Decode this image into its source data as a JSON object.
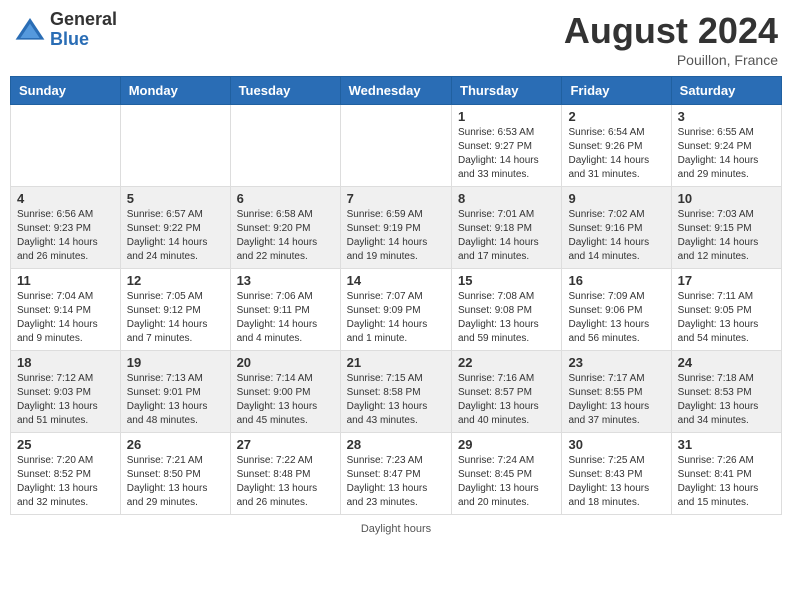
{
  "header": {
    "logo_general": "General",
    "logo_blue": "Blue",
    "month_year": "August 2024",
    "location": "Pouillon, France"
  },
  "days_of_week": [
    "Sunday",
    "Monday",
    "Tuesday",
    "Wednesday",
    "Thursday",
    "Friday",
    "Saturday"
  ],
  "weeks": [
    [
      {
        "day": "",
        "sunrise": "",
        "sunset": "",
        "daylight": ""
      },
      {
        "day": "",
        "sunrise": "",
        "sunset": "",
        "daylight": ""
      },
      {
        "day": "",
        "sunrise": "",
        "sunset": "",
        "daylight": ""
      },
      {
        "day": "",
        "sunrise": "",
        "sunset": "",
        "daylight": ""
      },
      {
        "day": "1",
        "sunrise": "6:53 AM",
        "sunset": "9:27 PM",
        "daylight": "14 hours and 33 minutes."
      },
      {
        "day": "2",
        "sunrise": "6:54 AM",
        "sunset": "9:26 PM",
        "daylight": "14 hours and 31 minutes."
      },
      {
        "day": "3",
        "sunrise": "6:55 AM",
        "sunset": "9:24 PM",
        "daylight": "14 hours and 29 minutes."
      }
    ],
    [
      {
        "day": "4",
        "sunrise": "6:56 AM",
        "sunset": "9:23 PM",
        "daylight": "14 hours and 26 minutes."
      },
      {
        "day": "5",
        "sunrise": "6:57 AM",
        "sunset": "9:22 PM",
        "daylight": "14 hours and 24 minutes."
      },
      {
        "day": "6",
        "sunrise": "6:58 AM",
        "sunset": "9:20 PM",
        "daylight": "14 hours and 22 minutes."
      },
      {
        "day": "7",
        "sunrise": "6:59 AM",
        "sunset": "9:19 PM",
        "daylight": "14 hours and 19 minutes."
      },
      {
        "day": "8",
        "sunrise": "7:01 AM",
        "sunset": "9:18 PM",
        "daylight": "14 hours and 17 minutes."
      },
      {
        "day": "9",
        "sunrise": "7:02 AM",
        "sunset": "9:16 PM",
        "daylight": "14 hours and 14 minutes."
      },
      {
        "day": "10",
        "sunrise": "7:03 AM",
        "sunset": "9:15 PM",
        "daylight": "14 hours and 12 minutes."
      }
    ],
    [
      {
        "day": "11",
        "sunrise": "7:04 AM",
        "sunset": "9:14 PM",
        "daylight": "14 hours and 9 minutes."
      },
      {
        "day": "12",
        "sunrise": "7:05 AM",
        "sunset": "9:12 PM",
        "daylight": "14 hours and 7 minutes."
      },
      {
        "day": "13",
        "sunrise": "7:06 AM",
        "sunset": "9:11 PM",
        "daylight": "14 hours and 4 minutes."
      },
      {
        "day": "14",
        "sunrise": "7:07 AM",
        "sunset": "9:09 PM",
        "daylight": "14 hours and 1 minute."
      },
      {
        "day": "15",
        "sunrise": "7:08 AM",
        "sunset": "9:08 PM",
        "daylight": "13 hours and 59 minutes."
      },
      {
        "day": "16",
        "sunrise": "7:09 AM",
        "sunset": "9:06 PM",
        "daylight": "13 hours and 56 minutes."
      },
      {
        "day": "17",
        "sunrise": "7:11 AM",
        "sunset": "9:05 PM",
        "daylight": "13 hours and 54 minutes."
      }
    ],
    [
      {
        "day": "18",
        "sunrise": "7:12 AM",
        "sunset": "9:03 PM",
        "daylight": "13 hours and 51 minutes."
      },
      {
        "day": "19",
        "sunrise": "7:13 AM",
        "sunset": "9:01 PM",
        "daylight": "13 hours and 48 minutes."
      },
      {
        "day": "20",
        "sunrise": "7:14 AM",
        "sunset": "9:00 PM",
        "daylight": "13 hours and 45 minutes."
      },
      {
        "day": "21",
        "sunrise": "7:15 AM",
        "sunset": "8:58 PM",
        "daylight": "13 hours and 43 minutes."
      },
      {
        "day": "22",
        "sunrise": "7:16 AM",
        "sunset": "8:57 PM",
        "daylight": "13 hours and 40 minutes."
      },
      {
        "day": "23",
        "sunrise": "7:17 AM",
        "sunset": "8:55 PM",
        "daylight": "13 hours and 37 minutes."
      },
      {
        "day": "24",
        "sunrise": "7:18 AM",
        "sunset": "8:53 PM",
        "daylight": "13 hours and 34 minutes."
      }
    ],
    [
      {
        "day": "25",
        "sunrise": "7:20 AM",
        "sunset": "8:52 PM",
        "daylight": "13 hours and 32 minutes."
      },
      {
        "day": "26",
        "sunrise": "7:21 AM",
        "sunset": "8:50 PM",
        "daylight": "13 hours and 29 minutes."
      },
      {
        "day": "27",
        "sunrise": "7:22 AM",
        "sunset": "8:48 PM",
        "daylight": "13 hours and 26 minutes."
      },
      {
        "day": "28",
        "sunrise": "7:23 AM",
        "sunset": "8:47 PM",
        "daylight": "13 hours and 23 minutes."
      },
      {
        "day": "29",
        "sunrise": "7:24 AM",
        "sunset": "8:45 PM",
        "daylight": "13 hours and 20 minutes."
      },
      {
        "day": "30",
        "sunrise": "7:25 AM",
        "sunset": "8:43 PM",
        "daylight": "13 hours and 18 minutes."
      },
      {
        "day": "31",
        "sunrise": "7:26 AM",
        "sunset": "8:41 PM",
        "daylight": "13 hours and 15 minutes."
      }
    ]
  ],
  "footer": {
    "daylight_label": "Daylight hours"
  }
}
